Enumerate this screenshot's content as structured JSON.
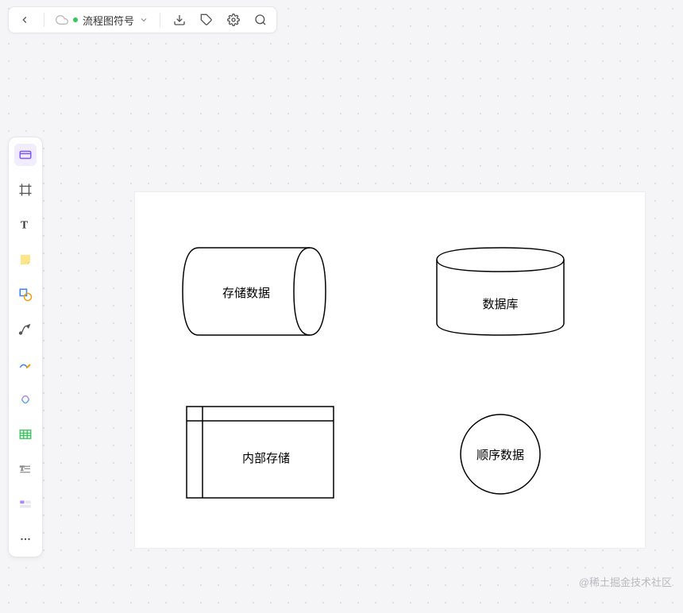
{
  "toolbar": {
    "doc_title": "流程图符号"
  },
  "shapes": {
    "stored_data": {
      "label": "存储数据"
    },
    "database": {
      "label": "数据库"
    },
    "internal_storage": {
      "label": "内部存储"
    },
    "sequential_data": {
      "label": "顺序数据"
    }
  },
  "watermark": "@稀土掘金技术社区"
}
